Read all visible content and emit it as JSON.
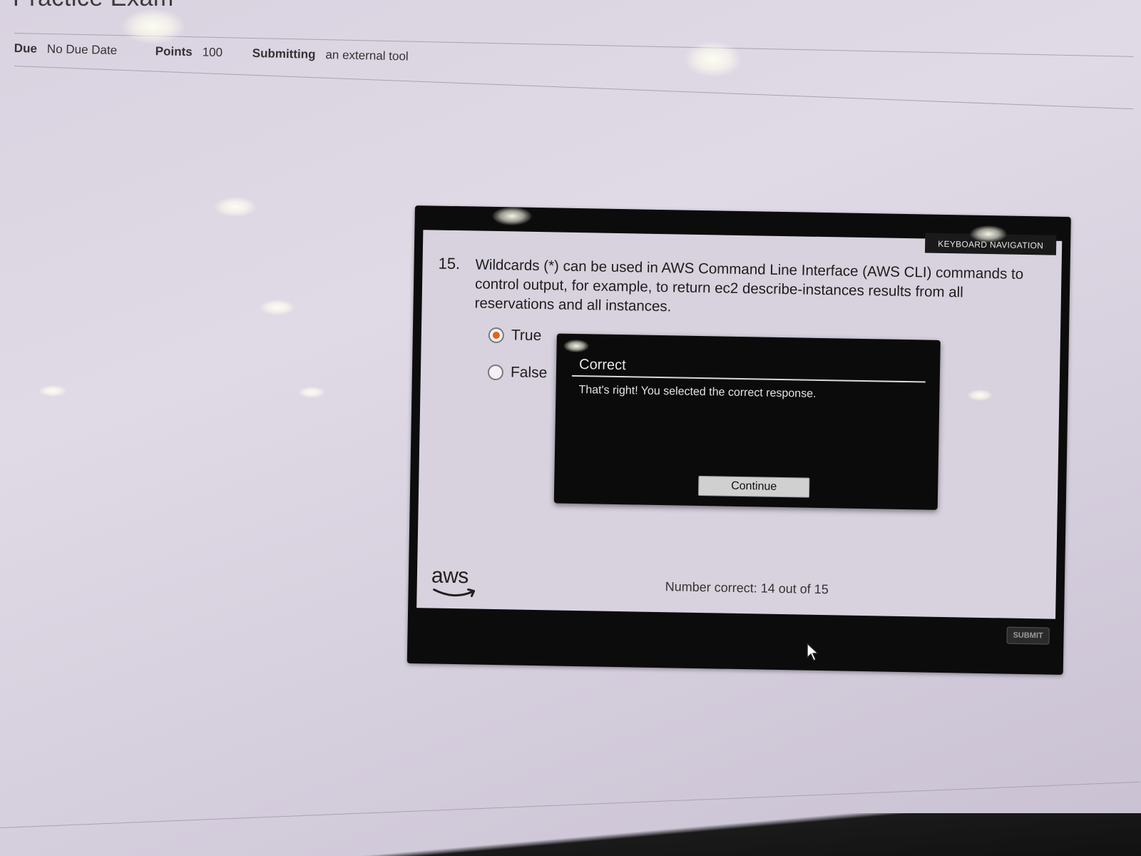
{
  "page": {
    "title": "Practice Exam"
  },
  "assignment_meta": {
    "due_label": "Due",
    "due_value": "No Due Date",
    "points_label": "Points",
    "points_value": "100",
    "submitting_label": "Submitting",
    "submitting_value": "an external tool"
  },
  "player": {
    "keyboard_nav_label": "KEYBOARD NAVIGATION",
    "question_number": "15.",
    "question_text": "Wildcards (*) can be used in AWS Command Line Interface (AWS CLI) commands to control output, for example, to return ec2 describe-instances results from all reservations and all instances.",
    "options": [
      {
        "label": "True",
        "selected": true
      },
      {
        "label": "False",
        "selected": false
      }
    ],
    "feedback": {
      "title": "Correct",
      "message": "That's right!  You selected the correct response.",
      "continue_label": "Continue"
    },
    "logo_text": "aws",
    "score_text": "Number correct: 14 out of 15",
    "submit_label": "SUBMIT"
  },
  "colors": {
    "radio_selected": "#e2631c",
    "player_frame": "#0c0c0c",
    "aws_smile": "#1f1f1f"
  }
}
